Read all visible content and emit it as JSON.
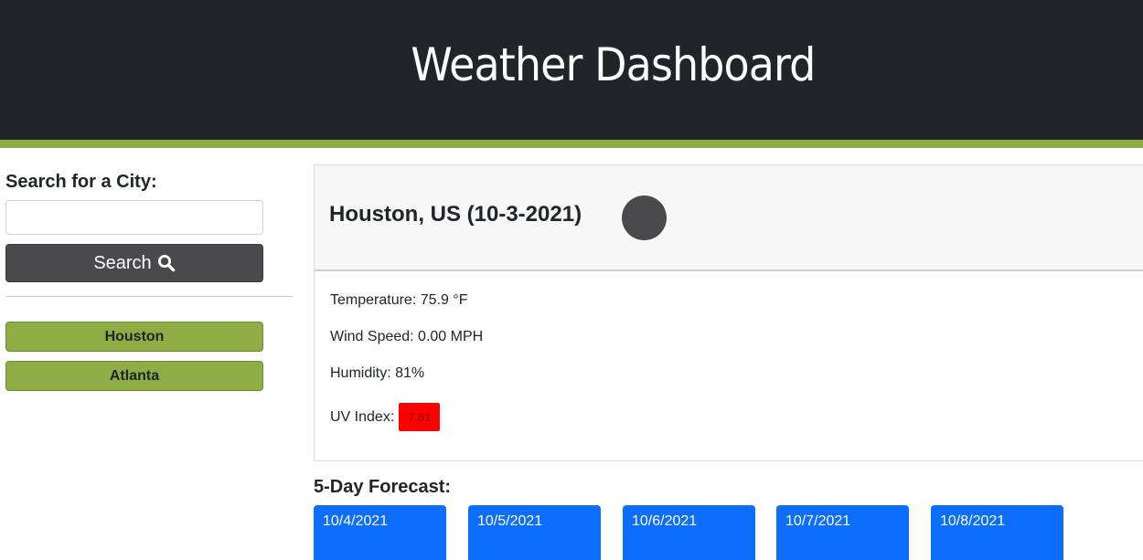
{
  "header": {
    "title": "Weather Dashboard"
  },
  "sidebar": {
    "search_label": "Search for a City:",
    "search_input_value": "",
    "search_input_placeholder": "",
    "search_button_label": "Search",
    "search_button_icon": "search-icon",
    "history": [
      {
        "label": "Houston"
      },
      {
        "label": "Atlanta"
      }
    ]
  },
  "current": {
    "title": "Houston, US (10-3-2021)",
    "icon": "weather-icon",
    "temperature": "Temperature: 75.9 °F",
    "wind": "Wind Speed: 0.00 MPH",
    "humidity": "Humidity: 81%",
    "uv_label": "UV Index:",
    "uv_value": "7.61"
  },
  "forecast": {
    "title": "5-Day Forecast:",
    "days": [
      {
        "date": "10/4/2021"
      },
      {
        "date": "10/5/2021"
      },
      {
        "date": "10/6/2021"
      },
      {
        "date": "10/7/2021"
      },
      {
        "date": "10/8/2021"
      }
    ]
  },
  "colors": {
    "header_bg": "#212529",
    "accent": "#8fad45",
    "search_button": "#4a4a4d",
    "forecast_card": "#0d6efd",
    "uv_high": "#ff0000"
  }
}
